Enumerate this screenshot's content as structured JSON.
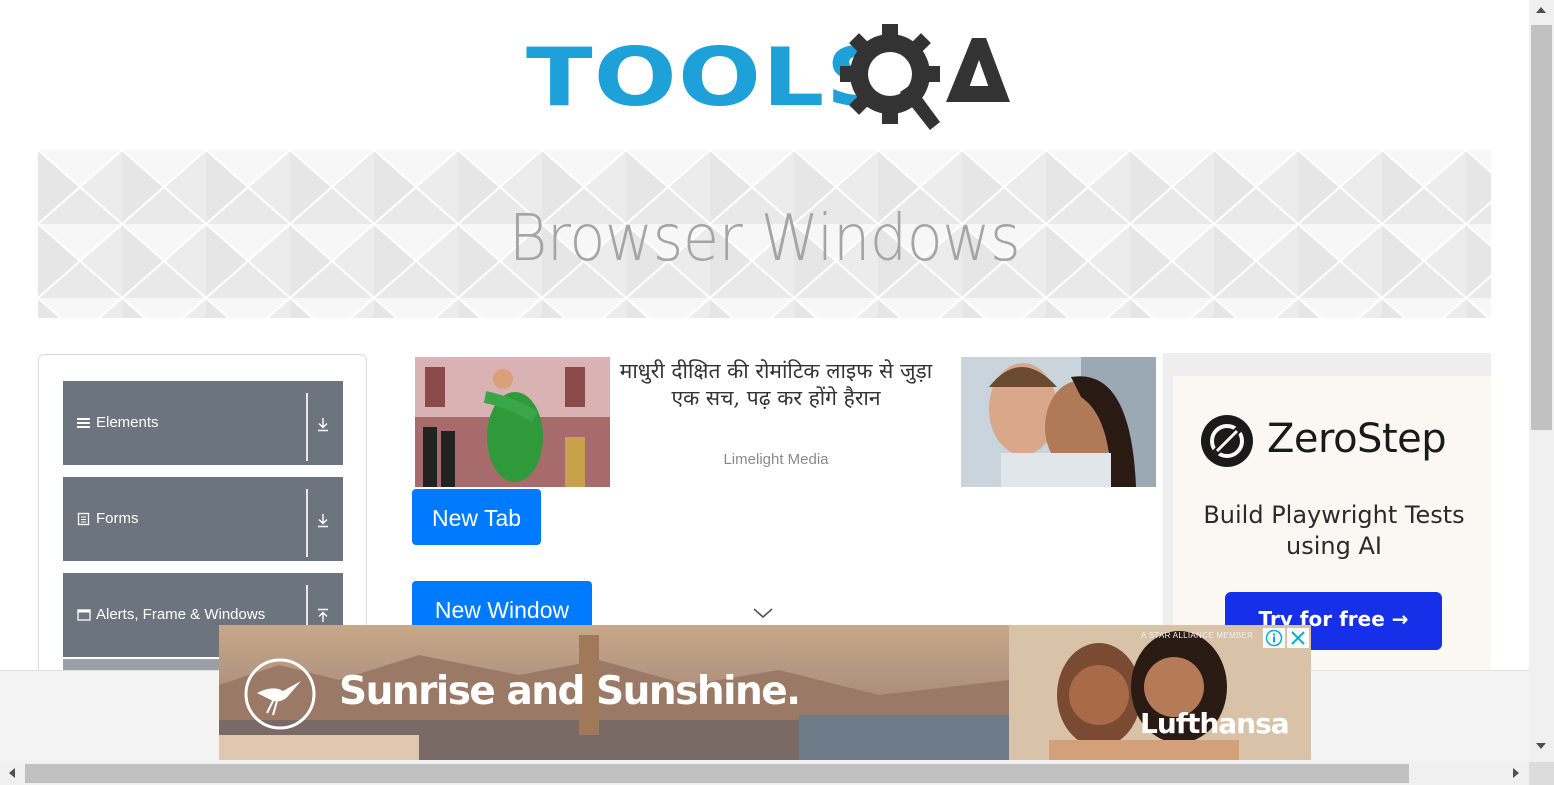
{
  "header": {
    "logo_text": "TOOLSQA",
    "logo_colors": {
      "tools": "#1da1d8",
      "qa": "#333333"
    }
  },
  "banner": {
    "title": "Browser Windows"
  },
  "sidebar": {
    "groups": [
      {
        "label": "Elements",
        "icon": "hamburger-icon",
        "arrow": "download-arrow-icon"
      },
      {
        "label": "Forms",
        "icon": "document-icon",
        "arrow": "download-arrow-icon"
      },
      {
        "label": "Alerts, Frame & Windows",
        "icon": "window-icon",
        "arrow": "upload-arrow-icon"
      }
    ]
  },
  "native_ad": {
    "headline": "माधुरी दीक्षित की रोमांटिक लाइफ से जुड़ा एक सच, पढ़ कर होंगे हैरान",
    "source": "Limelight Media"
  },
  "buttons": {
    "new_tab": "New Tab",
    "new_window": "New Window"
  },
  "right_ad": {
    "brand": "ZeroStep",
    "tagline": "Build Playwright Tests using AI",
    "cta": "Try for free →",
    "cta_color": "#1530e8"
  },
  "bottom_ad": {
    "headline": "Sunrise and Sunshine.",
    "brand": "Lufthansa",
    "alliance": "A STAR ALLIANCE MEMBER",
    "info_icon": "info-icon",
    "close_icon": "close-icon"
  },
  "colors": {
    "primary_button": "#007bff",
    "sidebar_group": "#6c757d",
    "banner_title": "#a5a5a5"
  }
}
